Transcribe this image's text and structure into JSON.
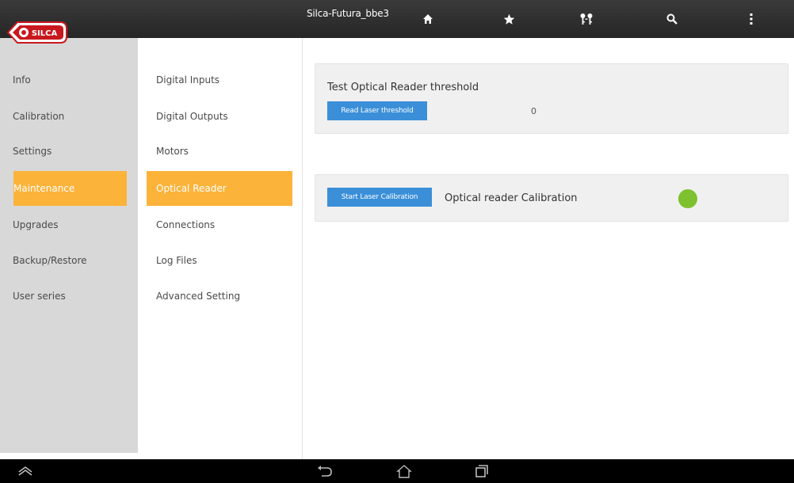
{
  "header": {
    "device_name": "Silca-Futura_bbe3",
    "logo_text": "SILCA",
    "icons": [
      "home-icon",
      "star-icon",
      "keys-icon",
      "search-icon",
      "overflow-menu-icon"
    ]
  },
  "sidebar": {
    "items": [
      {
        "label": "Info"
      },
      {
        "label": "Calibration"
      },
      {
        "label": "Settings"
      },
      {
        "label": "Maintenance",
        "active": true
      },
      {
        "label": "Upgrades"
      },
      {
        "label": "Backup/Restore"
      },
      {
        "label": "User series"
      }
    ]
  },
  "submenu": {
    "items": [
      {
        "label": "Digital Inputs"
      },
      {
        "label": "Digital Outputs"
      },
      {
        "label": "Motors"
      },
      {
        "label": "Optical Reader",
        "active": true
      },
      {
        "label": "Connections"
      },
      {
        "label": "Log Files"
      },
      {
        "label": "Advanced Setting"
      }
    ]
  },
  "threshold_panel": {
    "title": "Test Optical Reader threshold",
    "button_label": "Read Laser threshold",
    "value": "0"
  },
  "calibration_panel": {
    "button_label": "Start Laser Calibration",
    "label": "Optical reader Calibration",
    "status_color": "#7dc12e"
  },
  "navbar": {
    "icons": [
      "recent-apps-up-icon",
      "back-icon",
      "home-outline-icon",
      "recent-apps-icon"
    ]
  },
  "colors": {
    "accent": "#fbb33a",
    "button": "#3a8fd8",
    "topbar": "#2e2e2e",
    "sidebar": "#d8d8d8",
    "logo_red": "#c8181e"
  }
}
